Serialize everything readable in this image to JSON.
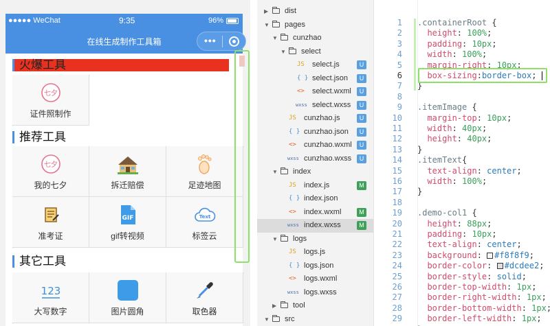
{
  "statusbar": {
    "carrier": "●●●●● WeChat",
    "time": "9:35",
    "battery": "96%"
  },
  "app": {
    "title": "在线生成制作工具箱",
    "menu_dots": "•••"
  },
  "sections": {
    "hot": {
      "title": "火爆工具",
      "items": [
        {
          "label": "证件照制作",
          "icon": "qixi-icon"
        }
      ]
    },
    "recommend": {
      "title": "推荐工具",
      "items": [
        {
          "label": "我的七夕",
          "icon": "qixi-icon"
        },
        {
          "label": "拆迁赔偿",
          "icon": "house-icon"
        },
        {
          "label": "足迹地图",
          "icon": "footprint-icon"
        },
        {
          "label": "准考证",
          "icon": "ticket-icon"
        },
        {
          "label": "gif转视频",
          "icon": "gif-icon"
        },
        {
          "label": "标签云",
          "icon": "tag-cloud-icon"
        }
      ]
    },
    "other": {
      "title": "其它工具",
      "items": [
        {
          "label": "大写数字",
          "icon": "numbers-icon"
        },
        {
          "label": "图片圆角",
          "icon": "rounded-image-icon"
        },
        {
          "label": "取色器",
          "icon": "color-picker-icon"
        }
      ]
    }
  },
  "icon_text": {
    "qixi": "七夕",
    "gif": "GIF",
    "tagcloud": "Text",
    "numbers": "123"
  },
  "tree": [
    {
      "name": "dist",
      "type": "folder",
      "open": false
    },
    {
      "name": "pages",
      "type": "folder",
      "open": true
    },
    {
      "name": "cunzhao",
      "type": "folder",
      "open": true
    },
    {
      "name": "select",
      "type": "folder",
      "open": true
    },
    {
      "name": "select.js",
      "type": "js",
      "badge": "U"
    },
    {
      "name": "select.json",
      "type": "json",
      "badge": "U"
    },
    {
      "name": "select.wxml",
      "type": "wxml",
      "badge": "U"
    },
    {
      "name": "select.wxss",
      "type": "wxss",
      "badge": "U"
    },
    {
      "name": "cunzhao.js",
      "type": "js",
      "badge": "U"
    },
    {
      "name": "cunzhao.json",
      "type": "json",
      "badge": "U"
    },
    {
      "name": "cunzhao.wxml",
      "type": "wxml",
      "badge": "U"
    },
    {
      "name": "cunzhao.wxss",
      "type": "wxss",
      "badge": "U"
    },
    {
      "name": "index",
      "type": "folder",
      "open": true
    },
    {
      "name": "index.js",
      "type": "js",
      "badge": "M"
    },
    {
      "name": "index.json",
      "type": "json",
      "badge": ""
    },
    {
      "name": "index.wxml",
      "type": "wxml",
      "badge": "M"
    },
    {
      "name": "index.wxss",
      "type": "wxss",
      "badge": "M",
      "selected": true
    },
    {
      "name": "logs",
      "type": "folder",
      "open": true
    },
    {
      "name": "logs.js",
      "type": "js",
      "badge": ""
    },
    {
      "name": "logs.json",
      "type": "json",
      "badge": ""
    },
    {
      "name": "logs.wxml",
      "type": "wxml",
      "badge": ""
    },
    {
      "name": "logs.wxss",
      "type": "wxss",
      "badge": ""
    },
    {
      "name": "tool",
      "type": "folder",
      "open": false
    },
    {
      "name": "src",
      "type": "folder",
      "open": true
    }
  ],
  "file_glyphs": {
    "js": "JS",
    "json": "{ }",
    "wxml": "<>",
    "wxss": "wxss"
  },
  "colors": {
    "accent": "#4a90e2",
    "highlight": "#8ee06b",
    "hot_bar": "#e8321f",
    "badge_u": "#5aa0e0",
    "badge_m": "#3fa05a"
  },
  "code": {
    "current_line": 6,
    "lines": [
      [
        [
          "sel",
          ".containerRoot "
        ],
        [
          "brk",
          "{"
        ]
      ],
      [
        [
          "prop",
          "  height"
        ],
        [
          "brk",
          ": "
        ],
        [
          "num",
          "100%"
        ],
        [
          "brk",
          ";"
        ]
      ],
      [
        [
          "prop",
          "  padding"
        ],
        [
          "brk",
          ": "
        ],
        [
          "num",
          "10px"
        ],
        [
          "brk",
          ";"
        ]
      ],
      [
        [
          "prop",
          "  width"
        ],
        [
          "brk",
          ": "
        ],
        [
          "num",
          "100%"
        ],
        [
          "brk",
          ";"
        ]
      ],
      [
        [
          "prop",
          "  margin-right"
        ],
        [
          "brk",
          ": "
        ],
        [
          "num",
          "10px"
        ],
        [
          "brk",
          ";"
        ]
      ],
      [
        [
          "prop",
          "  box-sizing"
        ],
        [
          "brk",
          ":"
        ],
        [
          "val",
          "border-box"
        ],
        [
          "brk",
          ";"
        ]
      ],
      [
        [
          "brk",
          "}"
        ]
      ],
      [],
      [
        [
          "sel",
          ".itemImage "
        ],
        [
          "brk",
          "{"
        ]
      ],
      [
        [
          "prop",
          "  margin-top"
        ],
        [
          "brk",
          ": "
        ],
        [
          "num",
          "10px"
        ],
        [
          "brk",
          ";"
        ]
      ],
      [
        [
          "prop",
          "  width"
        ],
        [
          "brk",
          ": "
        ],
        [
          "num",
          "40px"
        ],
        [
          "brk",
          ";"
        ]
      ],
      [
        [
          "prop",
          "  height"
        ],
        [
          "brk",
          ": "
        ],
        [
          "num",
          "40px"
        ],
        [
          "brk",
          ";"
        ]
      ],
      [
        [
          "brk",
          "}"
        ]
      ],
      [
        [
          "sel",
          ".itemText"
        ],
        [
          "brk",
          "{"
        ]
      ],
      [
        [
          "prop",
          "  text-align"
        ],
        [
          "brk",
          ": "
        ],
        [
          "val",
          "center"
        ],
        [
          "brk",
          ";"
        ]
      ],
      [
        [
          "prop",
          "  width"
        ],
        [
          "brk",
          ": "
        ],
        [
          "num",
          "100%"
        ],
        [
          "brk",
          ";"
        ]
      ],
      [
        [
          "brk",
          "}"
        ]
      ],
      [],
      [
        [
          "sel",
          ".demo-col1 "
        ],
        [
          "brk",
          "{"
        ]
      ],
      [
        [
          "prop",
          "  height"
        ],
        [
          "brk",
          ": "
        ],
        [
          "num",
          "88px"
        ],
        [
          "brk",
          ";"
        ]
      ],
      [
        [
          "prop",
          "  padding"
        ],
        [
          "brk",
          ": "
        ],
        [
          "num",
          "10px"
        ],
        [
          "brk",
          ";"
        ]
      ],
      [
        [
          "prop",
          "  text-align"
        ],
        [
          "brk",
          ": "
        ],
        [
          "val",
          "center"
        ],
        [
          "brk",
          ";"
        ]
      ],
      [
        [
          "prop",
          "  background"
        ],
        [
          "brk",
          ": "
        ],
        [
          "sw",
          "#f8f8f9"
        ],
        [
          "val",
          "#f8f8f9"
        ],
        [
          "brk",
          ";"
        ]
      ],
      [
        [
          "prop",
          "  border-color"
        ],
        [
          "brk",
          ": "
        ],
        [
          "sw",
          "#dcdee2"
        ],
        [
          "val",
          "#dcdee2"
        ],
        [
          "brk",
          ";"
        ]
      ],
      [
        [
          "prop",
          "  border-style"
        ],
        [
          "brk",
          ": "
        ],
        [
          "val",
          "solid"
        ],
        [
          "brk",
          ";"
        ]
      ],
      [
        [
          "prop",
          "  border-top-width"
        ],
        [
          "brk",
          ": "
        ],
        [
          "num",
          "1px"
        ],
        [
          "brk",
          ";"
        ]
      ],
      [
        [
          "prop",
          "  border-right-width"
        ],
        [
          "brk",
          ": "
        ],
        [
          "num",
          "1px"
        ],
        [
          "brk",
          ";"
        ]
      ],
      [
        [
          "prop",
          "  border-bottom-width"
        ],
        [
          "brk",
          ": "
        ],
        [
          "num",
          "1px"
        ],
        [
          "brk",
          ";"
        ]
      ],
      [
        [
          "prop",
          "  border-left-width"
        ],
        [
          "brk",
          ": "
        ],
        [
          "num",
          "1px"
        ],
        [
          "brk",
          ";"
        ]
      ],
      [
        [
          "brk",
          "}"
        ]
      ]
    ]
  }
}
